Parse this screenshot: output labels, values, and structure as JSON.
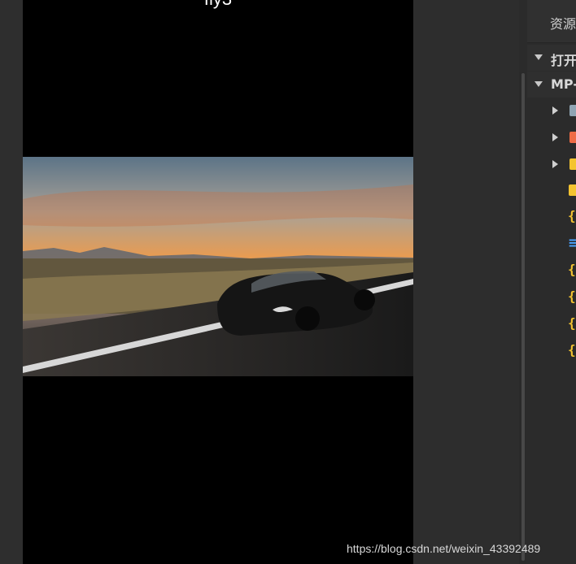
{
  "simulator": {
    "page_title": "fly3"
  },
  "explorer": {
    "title": "资源管理器",
    "sections": [
      {
        "label": "打开的编辑器"
      },
      {
        "label": "MP-"
      }
    ]
  },
  "colors": {
    "folder_gray": "#8fa4b3",
    "folder_orange": "#ef6b45",
    "folder_yellow": "#f4c430",
    "json_yellow": "#f2c230",
    "vue_blue": "#4aa3ff"
  },
  "watermark": "https://blog.csdn.net/weixin_43392489"
}
